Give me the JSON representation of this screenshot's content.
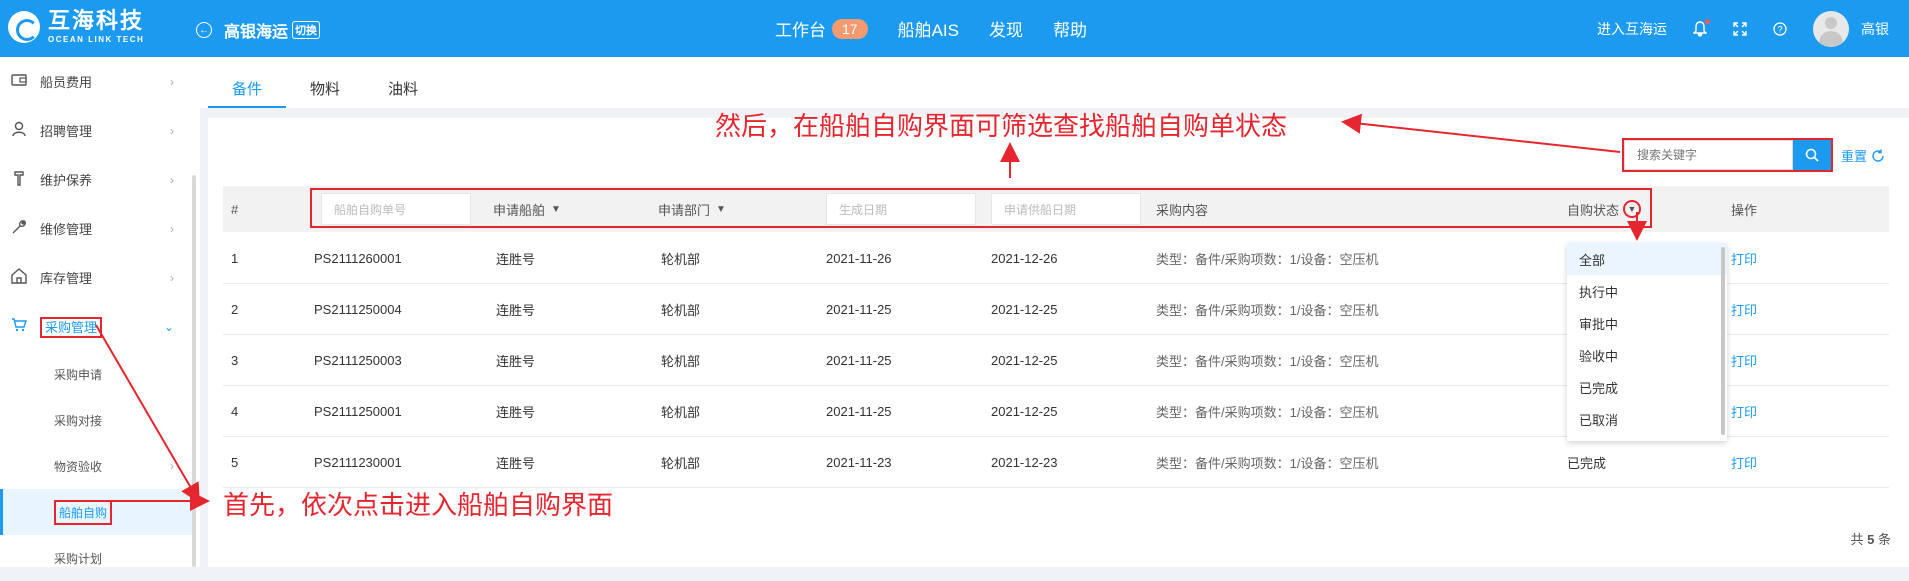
{
  "header": {
    "logo_cn": "互海科技",
    "logo_en": "OCEAN LINK TECH",
    "company": "高银海运",
    "switch_label": "切换",
    "nav": [
      {
        "label": "工作台",
        "badge": "17"
      },
      {
        "label": "船舶AIS"
      },
      {
        "label": "发现"
      },
      {
        "label": "帮助"
      }
    ],
    "enter_label": "进入互海运",
    "user_name": "高银"
  },
  "sidebar": {
    "items": [
      {
        "label": "船员费用",
        "icon": "wallet-icon"
      },
      {
        "label": "招聘管理",
        "icon": "person-icon"
      },
      {
        "label": "维护保养",
        "icon": "wrench-icon"
      },
      {
        "label": "维修管理",
        "icon": "tool-icon"
      },
      {
        "label": "库存管理",
        "icon": "warehouse-icon"
      },
      {
        "label": "采购管理",
        "icon": "cart-icon"
      }
    ],
    "sub_items": [
      "采购申请",
      "采购对接",
      "物资验收",
      "船舶自购",
      "采购计划"
    ]
  },
  "tabs": [
    "备件",
    "物料",
    "油料"
  ],
  "search": {
    "placeholder": "搜索关键字",
    "reset_label": "重置"
  },
  "table": {
    "headers": {
      "index": "#",
      "order_no_placeholder": "船舶自购单号",
      "ship": "申请船舶",
      "dept": "申请部门",
      "gen_date_placeholder": "生成日期",
      "supply_date_placeholder": "申请供船日期",
      "content": "采购内容",
      "status": "自购状态",
      "action": "操作"
    },
    "rows": [
      {
        "idx": "1",
        "no": "PS2111260001",
        "ship": "连胜号",
        "dept": "轮机部",
        "gen": "2021-11-26",
        "supply": "2021-12-26",
        "content": "类型：备件/采购项数：1/设备：空压机",
        "status": "",
        "action": "打印"
      },
      {
        "idx": "2",
        "no": "PS2111250004",
        "ship": "连胜号",
        "dept": "轮机部",
        "gen": "2021-11-25",
        "supply": "2021-12-25",
        "content": "类型：备件/采购项数：1/设备：空压机",
        "status": "",
        "action": "打印"
      },
      {
        "idx": "3",
        "no": "PS2111250003",
        "ship": "连胜号",
        "dept": "轮机部",
        "gen": "2021-11-25",
        "supply": "2021-12-25",
        "content": "类型：备件/采购项数：1/设备：空压机",
        "status": "",
        "action": "打印"
      },
      {
        "idx": "4",
        "no": "PS2111250001",
        "ship": "连胜号",
        "dept": "轮机部",
        "gen": "2021-11-25",
        "supply": "2021-12-25",
        "content": "类型：备件/采购项数：1/设备：空压机",
        "status": "",
        "action": "打印"
      },
      {
        "idx": "5",
        "no": "PS2111230001",
        "ship": "连胜号",
        "dept": "轮机部",
        "gen": "2021-11-23",
        "supply": "2021-12-23",
        "content": "类型：备件/采购项数：1/设备：空压机",
        "status": "已完成",
        "action": "打印"
      }
    ]
  },
  "status_dropdown": [
    "全部",
    "执行中",
    "审批中",
    "验收中",
    "已完成",
    "已取消"
  ],
  "footer": {
    "prefix": "共",
    "count": "5",
    "suffix": "条"
  },
  "annotations": {
    "top": "然后，在船舶自购界面可筛选查找船舶自购单状态",
    "bottom": "首先，依次点击进入船舶自购界面"
  },
  "colors": {
    "primary": "#1b9af0",
    "annotation": "#e6262e",
    "badge": "#f49a6f"
  }
}
